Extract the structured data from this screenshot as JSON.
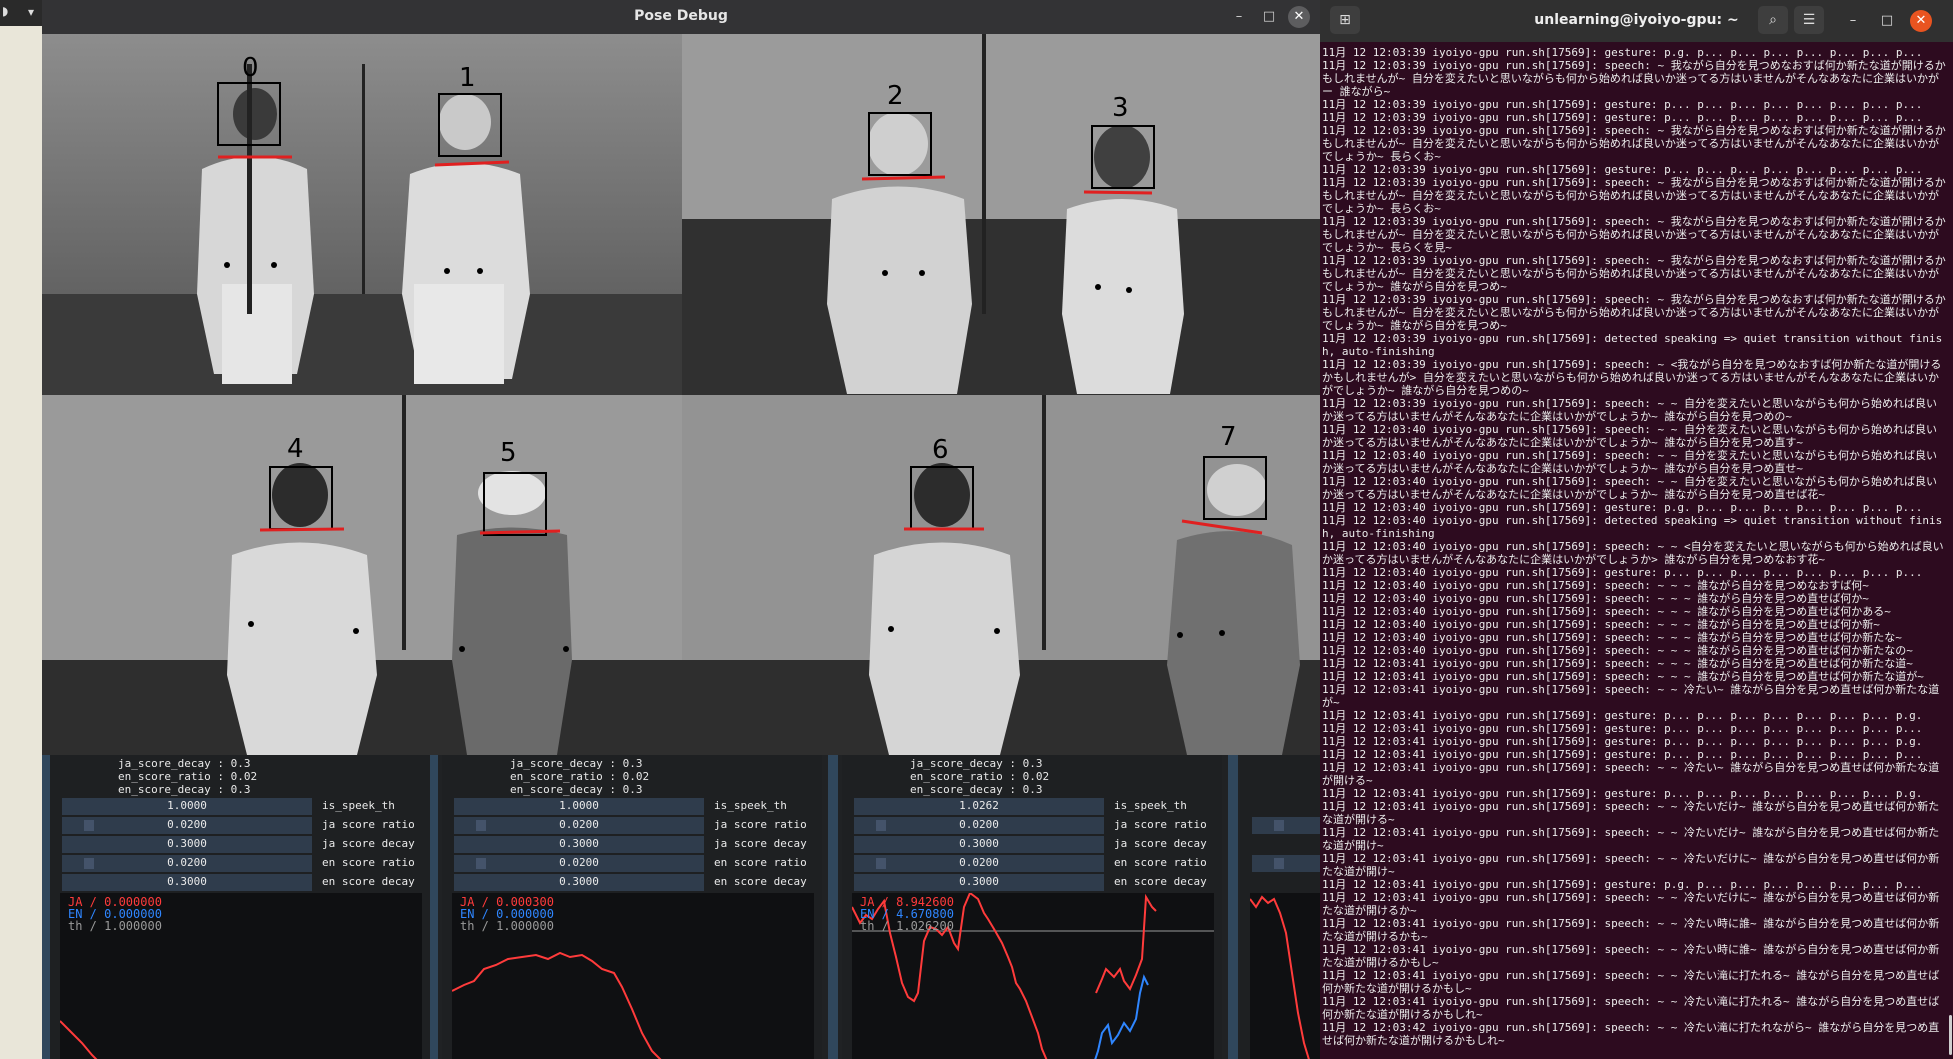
{
  "pose_window": {
    "title": "Pose Debug",
    "minimize": "–",
    "maximize": "□",
    "close": "✕",
    "person_ids": [
      "0",
      "1",
      "2",
      "3",
      "4",
      "5",
      "6",
      "7"
    ]
  },
  "panels": [
    {
      "config": [
        "ja_score_decay : 0.3",
        "en_score_ratio : 0.02",
        "en_score_decay : 0.3"
      ],
      "sliders": [
        {
          "value": "1.0000",
          "label": "is_speek_th"
        },
        {
          "value": "0.0200",
          "label": "ja score ratio"
        },
        {
          "value": "0.3000",
          "label": "ja score decay"
        },
        {
          "value": "0.0200",
          "label": "en score ratio"
        },
        {
          "value": "0.3000",
          "label": "en score decay"
        }
      ],
      "legend": [
        "JA / 0.000000",
        "EN / 0.000000",
        "th / 1.000000"
      ]
    },
    {
      "config": [
        "ja_score_decay : 0.3",
        "en_score_ratio : 0.02",
        "en_score_decay : 0.3"
      ],
      "sliders": [
        {
          "value": "1.0000",
          "label": "is_speek_th"
        },
        {
          "value": "0.0200",
          "label": "ja score ratio"
        },
        {
          "value": "0.3000",
          "label": "ja score decay"
        },
        {
          "value": "0.0200",
          "label": "en score ratio"
        },
        {
          "value": "0.3000",
          "label": "en score decay"
        }
      ],
      "legend": [
        "JA / 0.000300",
        "EN / 0.000000",
        "th / 1.000000"
      ]
    },
    {
      "config": [
        "ja_score_decay : 0.3",
        "en_score_ratio : 0.02",
        "en_score_decay : 0.3"
      ],
      "sliders": [
        {
          "value": "1.0262",
          "label": "is_speek_th"
        },
        {
          "value": "0.0200",
          "label": "ja score ratio"
        },
        {
          "value": "0.3000",
          "label": "ja score decay"
        },
        {
          "value": "0.0200",
          "label": "en score ratio"
        },
        {
          "value": "0.3000",
          "label": "en score decay"
        }
      ],
      "legend": [
        "JA / 8.942600",
        "EN / 4.670800",
        "th / 1.026200"
      ]
    }
  ],
  "colors": {
    "ja": "#ff3b3b",
    "en": "#2f86ff",
    "th": "#9a9a9a",
    "accent": "#e95420"
  },
  "terminal": {
    "title": "unlearning@iyoiyo-gpu: ~",
    "lines": [
      "11月 12 12:03:39 iyoiyo-gpu run.sh[17569]: gesture: p.g. p... p... p... p... p... p... p...",
      "11月 12 12:03:39 iyoiyo-gpu run.sh[17569]: speech: ~ 我ながら自分を見つめなおすば何か新たな道が開けるかもしれませんが~ 自分を変えたいと思いながらも何から始めれば良いか迷ってる方はいませんがそんなあなたに企業はいかがー 誰ながら~",
      "11月 12 12:03:39 iyoiyo-gpu run.sh[17569]: gesture: p... p... p... p... p... p... p... p...",
      "11月 12 12:03:39 iyoiyo-gpu run.sh[17569]: gesture: p... p... p... p... p... p... p... p...",
      "11月 12 12:03:39 iyoiyo-gpu run.sh[17569]: speech: ~ 我ながら自分を見つめなおすば何か新たな道が開けるかもしれませんが~ 自分を変えたいと思いながらも何から始めれば良いか迷ってる方はいませんがそんなあなたに企業はいかがでしょうか~ 長らくお~",
      "11月 12 12:03:39 iyoiyo-gpu run.sh[17569]: gesture: p... p... p... p... p... p... p... p...",
      "11月 12 12:03:39 iyoiyo-gpu run.sh[17569]: speech: ~ 我ながら自分を見つめなおすば何か新たな道が開けるかもしれませんが~ 自分を変えたいと思いながらも何から始めれば良いか迷ってる方はいませんがそんなあなたに企業はいかがでしょうか~ 長らくお~",
      "11月 12 12:03:39 iyoiyo-gpu run.sh[17569]: speech: ~ 我ながら自分を見つめなおすば何か新たな道が開けるかもしれませんが~ 自分を変えたいと思いながらも何から始めれば良いか迷ってる方はいませんがそんなあなたに企業はいかがでしょうか~ 長らくを見~",
      "11月 12 12:03:39 iyoiyo-gpu run.sh[17569]: speech: ~ 我ながら自分を見つめなおすば何か新たな道が開けるかもしれませんが~ 自分を変えたいと思いながらも何から始めれば良いか迷ってる方はいませんがそんなあなたに企業はいかがでしょうか~ 誰ながら自分を見つめ~",
      "11月 12 12:03:39 iyoiyo-gpu run.sh[17569]: speech: ~ 我ながら自分を見つめなおすば何か新たな道が開けるかもしれませんが~ 自分を変えたいと思いながらも何から始めれば良いか迷ってる方はいませんがそんなあなたに企業はいかがでしょうか~ 誰ながら自分を見つめ~",
      "11月 12 12:03:39 iyoiyo-gpu run.sh[17569]: detected speaking => quiet transition without finish, auto-finishing",
      "11月 12 12:03:39 iyoiyo-gpu run.sh[17569]: speech: ~ <我ながら自分を見つめなおすば何か新たな道が開けるかもしれませんが> 自分を変えたいと思いながらも何から始めれば良いか迷ってる方はいませんがそんなあなたに企業はいかがでしょうか~ 誰ながら自分を見つめの~",
      "11月 12 12:03:39 iyoiyo-gpu run.sh[17569]: speech: ~ ~ 自分を変えたいと思いながらも何から始めれば良いか迷ってる方はいませんがそんなあなたに企業はいかがでしょうか~ 誰ながら自分を見つめの~",
      "11月 12 12:03:40 iyoiyo-gpu run.sh[17569]: speech: ~ ~ 自分を変えたいと思いながらも何から始めれば良いか迷ってる方はいませんがそんなあなたに企業はいかがでしょうか~ 誰ながら自分を見つめ直す~",
      "11月 12 12:03:40 iyoiyo-gpu run.sh[17569]: speech: ~ ~ 自分を変えたいと思いながらも何から始めれば良いか迷ってる方はいませんがそんなあなたに企業はいかがでしょうか~ 誰ながら自分を見つめ直せ~",
      "11月 12 12:03:40 iyoiyo-gpu run.sh[17569]: speech: ~ ~ 自分を変えたいと思いながらも何から始めれば良いか迷ってる方はいませんがそんなあなたに企業はいかがでしょうか~ 誰ながら自分を見つめ直せば花~",
      "11月 12 12:03:40 iyoiyo-gpu run.sh[17569]: gesture: p.g. p... p... p... p... p... p... p...",
      "11月 12 12:03:40 iyoiyo-gpu run.sh[17569]: detected speaking => quiet transition without finish, auto-finishing",
      "11月 12 12:03:40 iyoiyo-gpu run.sh[17569]: speech: ~ ~ <自分を変えたいと思いながらも何から始めれば良いか迷ってる方はいませんがそんなあなたに企業はいかがでしょうか> 誰ながら自分を見つめなおす花~",
      "11月 12 12:03:40 iyoiyo-gpu run.sh[17569]: gesture: p... p... p... p... p... p... p... p...",
      "11月 12 12:03:40 iyoiyo-gpu run.sh[17569]: speech: ~ ~ ~ 誰ながら自分を見つめなおすば何~",
      "11月 12 12:03:40 iyoiyo-gpu run.sh[17569]: speech: ~ ~ ~ 誰ながら自分を見つめ直せば何か~",
      "11月 12 12:03:40 iyoiyo-gpu run.sh[17569]: speech: ~ ~ ~ 誰ながら自分を見つめ直せば何かある~",
      "11月 12 12:03:40 iyoiyo-gpu run.sh[17569]: speech: ~ ~ ~ 誰ながら自分を見つめ直せば何か新~",
      "11月 12 12:03:40 iyoiyo-gpu run.sh[17569]: speech: ~ ~ ~ 誰ながら自分を見つめ直せば何か新たな~",
      "11月 12 12:03:40 iyoiyo-gpu run.sh[17569]: speech: ~ ~ ~ 誰ながら自分を見つめ直せば何か新たなの~",
      "11月 12 12:03:41 iyoiyo-gpu run.sh[17569]: speech: ~ ~ ~ 誰ながら自分を見つめ直せば何か新たな道~",
      "11月 12 12:03:41 iyoiyo-gpu run.sh[17569]: speech: ~ ~ ~ 誰ながら自分を見つめ直せば何か新たな道が~",
      "11月 12 12:03:41 iyoiyo-gpu run.sh[17569]: speech: ~ ~ 冷たい~ 誰ながら自分を見つめ直せば何か新たな道が~",
      "11月 12 12:03:41 iyoiyo-gpu run.sh[17569]: gesture: p... p... p... p... p... p... p... p.g.",
      "11月 12 12:03:41 iyoiyo-gpu run.sh[17569]: gesture: p... p... p... p... p... p... p... p...",
      "11月 12 12:03:41 iyoiyo-gpu run.sh[17569]: gesture: p... p... p... p... p... p... p... p.g.",
      "11月 12 12:03:41 iyoiyo-gpu run.sh[17569]: gesture: p... p... p... p... p... p... p... p...",
      "11月 12 12:03:41 iyoiyo-gpu run.sh[17569]: speech: ~ ~ 冷たい~ 誰ながら自分を見つめ直せば何か新たな道が開ける~",
      "11月 12 12:03:41 iyoiyo-gpu run.sh[17569]: gesture: p... p... p... p... p... p... p... p.g.",
      "11月 12 12:03:41 iyoiyo-gpu run.sh[17569]: speech: ~ ~ 冷たいだけ~ 誰ながら自分を見つめ直せば何か新たな道が開ける~",
      "11月 12 12:03:41 iyoiyo-gpu run.sh[17569]: speech: ~ ~ 冷たいだけ~ 誰ながら自分を見つめ直せば何か新たな道が開け~",
      "11月 12 12:03:41 iyoiyo-gpu run.sh[17569]: speech: ~ ~ 冷たいだけに~ 誰ながら自分を見つめ直せば何か新たな道が開け~",
      "11月 12 12:03:41 iyoiyo-gpu run.sh[17569]: gesture: p.g. p... p... p... p... p... p... p...",
      "11月 12 12:03:41 iyoiyo-gpu run.sh[17569]: speech: ~ ~ 冷たいだけに~ 誰ながら自分を見つめ直せば何か新たな道が開けるか~",
      "11月 12 12:03:41 iyoiyo-gpu run.sh[17569]: speech: ~ ~ 冷たい時に誰~ 誰ながら自分を見つめ直せば何か新たな道が開けるかも~",
      "11月 12 12:03:41 iyoiyo-gpu run.sh[17569]: speech: ~ ~ 冷たい時に誰~ 誰ながら自分を見つめ直せば何か新たな道が開けるかもし~",
      "11月 12 12:03:41 iyoiyo-gpu run.sh[17569]: speech: ~ ~ 冷たい滝に打たれる~ 誰ながら自分を見つめ直せば何か新たな道が開けるかもし~",
      "11月 12 12:03:41 iyoiyo-gpu run.sh[17569]: speech: ~ ~ 冷たい滝に打たれる~ 誰ながら自分を見つめ直せば何か新たな道が開けるかもしれ~",
      "11月 12 12:03:42 iyoiyo-gpu run.sh[17569]: speech: ~ ~ 冷たい滝に打たれながら~ 誰ながら自分を見つめ直せば何か新たな道が開けるかもしれ~"
    ]
  }
}
